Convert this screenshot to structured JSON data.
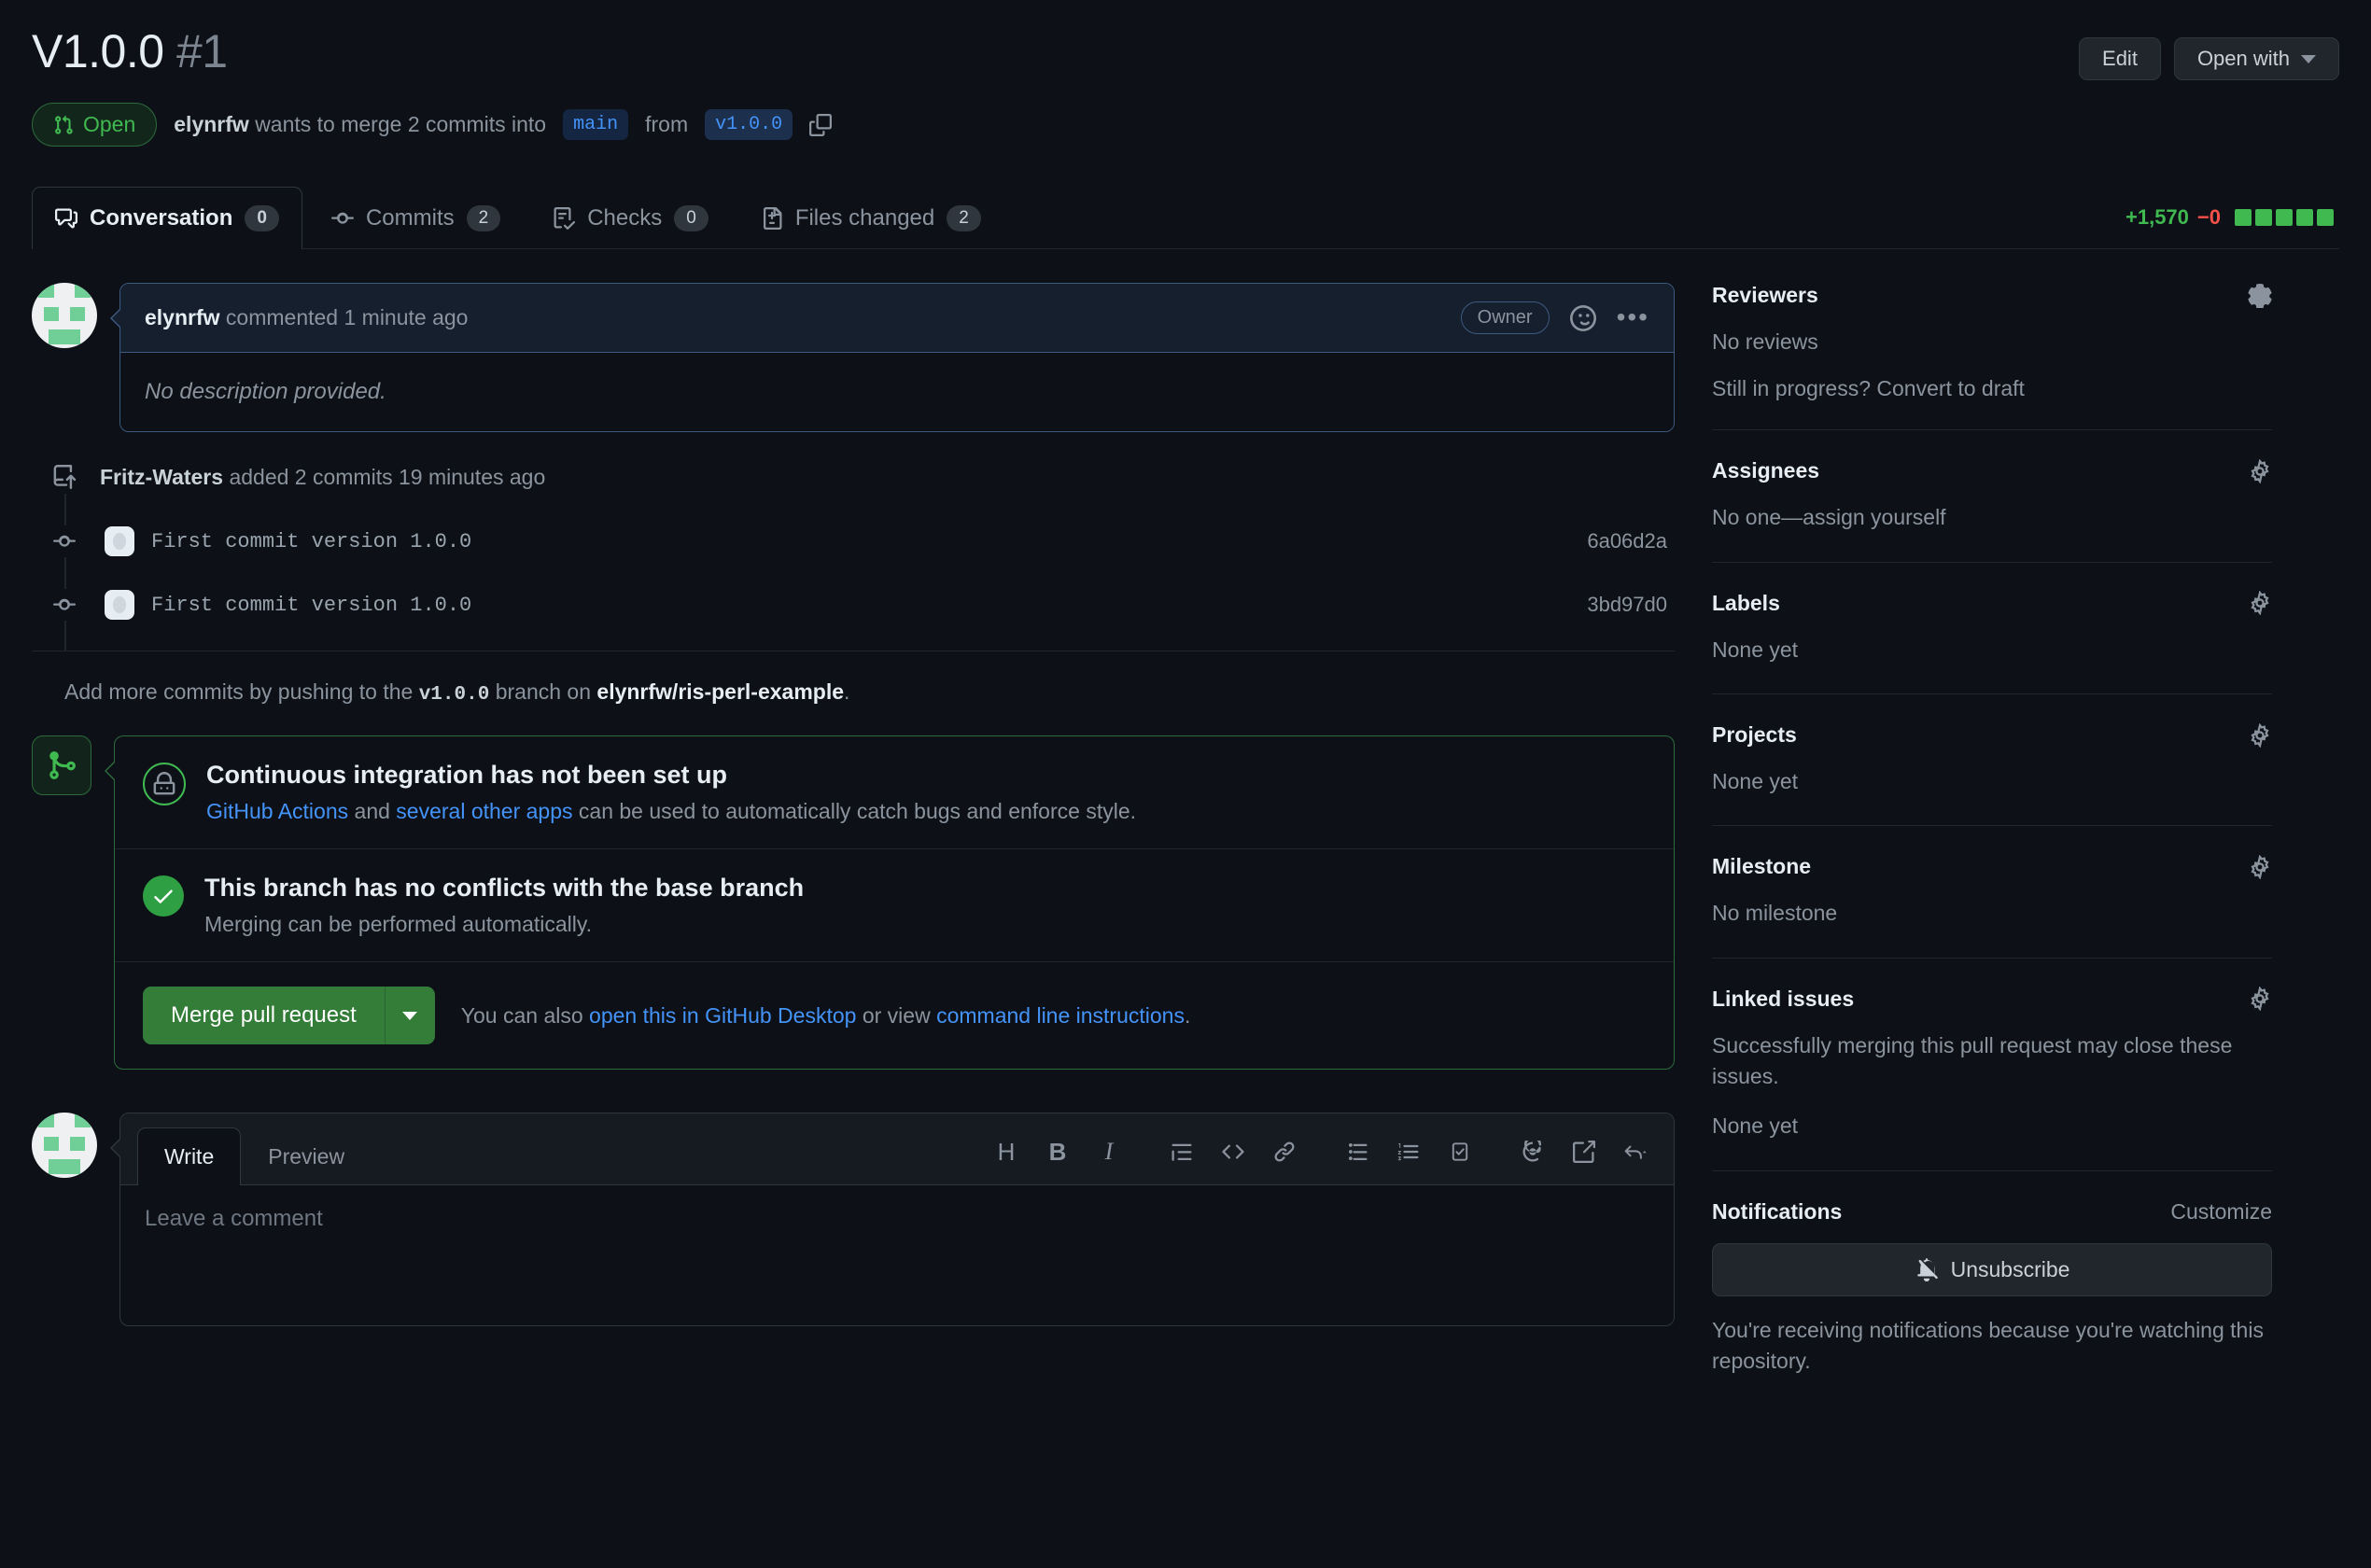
{
  "header": {
    "title": "V1.0.0",
    "number": "#1",
    "edit_label": "Edit",
    "open_with_label": "Open with"
  },
  "subheader": {
    "state": "Open",
    "author": "elynrfw",
    "text_before": "wants to merge 2 commits into",
    "base_branch": "main",
    "text_from": "from",
    "head_branch": "v1.0.0"
  },
  "tabs": [
    {
      "label": "Conversation",
      "count": "0"
    },
    {
      "label": "Commits",
      "count": "2"
    },
    {
      "label": "Checks",
      "count": "0"
    },
    {
      "label": "Files changed",
      "count": "2"
    }
  ],
  "diffstat": {
    "additions": "+1,570",
    "deletions": "−0",
    "blocks": 5
  },
  "comment": {
    "author": "elynrfw",
    "action": "commented 1 minute ago",
    "badge": "Owner",
    "body": "No description provided."
  },
  "timeline": {
    "commits_header_author": "Fritz-Waters",
    "commits_header_rest": "added 2 commits 19 minutes ago",
    "commits": [
      {
        "message": "First commit version 1.0.0",
        "sha": "6a06d2a"
      },
      {
        "message": "First commit version 1.0.0",
        "sha": "3bd97d0"
      }
    ],
    "push_note_before": "Add more commits by pushing to the",
    "push_note_branch": "v1.0.0",
    "push_note_middle": "branch on",
    "push_note_repo": "elynrfw/ris-perl-example",
    "push_note_end": "."
  },
  "merge_box": {
    "ci": {
      "title": "Continuous integration has not been set up",
      "link1": "GitHub Actions",
      "between": " and ",
      "link2": "several other apps",
      "rest": " can be used to automatically catch bugs and enforce style."
    },
    "conflicts": {
      "title": "This branch has no conflicts with the base branch",
      "desc": "Merging can be performed automatically."
    },
    "merge_button": "Merge pull request",
    "alt_before": "You can also ",
    "alt_link1": "open this in GitHub Desktop",
    "alt_middle": " or view ",
    "alt_link2": "command line instructions",
    "alt_end": "."
  },
  "editor": {
    "tabs": [
      "Write",
      "Preview"
    ],
    "placeholder": "Leave a comment",
    "tools": [
      "heading-icon",
      "bold-icon",
      "italic-icon",
      "quote-icon",
      "code-icon",
      "link-icon",
      "unordered-list-icon",
      "ordered-list-icon",
      "task-list-icon",
      "mention-icon",
      "saved-reply-icon",
      "reply-icon"
    ]
  },
  "sidebar": {
    "reviewers": {
      "title": "Reviewers",
      "value": "No reviews",
      "link": "Still in progress? Convert to draft"
    },
    "assignees": {
      "title": "Assignees",
      "value": "No one—assign yourself"
    },
    "labels": {
      "title": "Labels",
      "value": "None yet"
    },
    "projects": {
      "title": "Projects",
      "value": "None yet"
    },
    "milestone": {
      "title": "Milestone",
      "value": "No milestone"
    },
    "linked_issues": {
      "title": "Linked issues",
      "desc": "Successfully merging this pull request may close these issues.",
      "value": "None yet"
    },
    "notifications": {
      "title": "Notifications",
      "customize": "Customize",
      "button": "Unsubscribe",
      "desc": "You're receiving notifications because you're watching this repository."
    }
  },
  "colors": {
    "page_bg": "#0d1117",
    "open_green": "#3fb950",
    "merge_green": "#347d39",
    "link_blue": "#4493f8",
    "deletion_red": "#f85149"
  }
}
